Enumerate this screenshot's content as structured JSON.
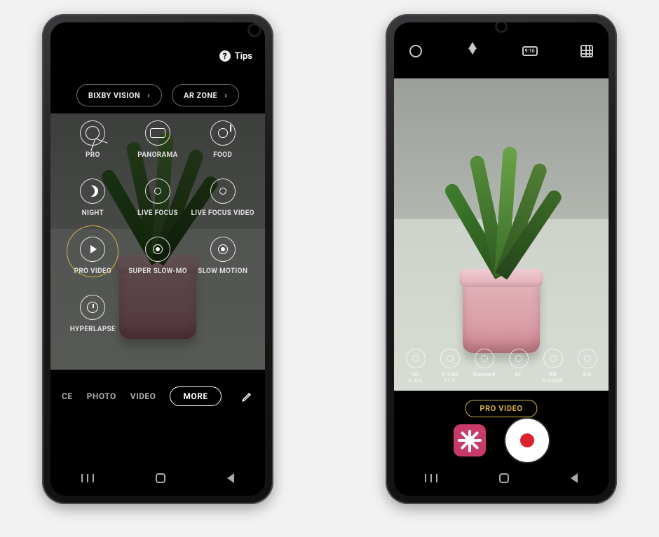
{
  "left": {
    "tips_label": "Tips",
    "chips": {
      "bixby": "BIXBY VISION",
      "arzone": "AR ZONE"
    },
    "modes": {
      "pro": "PRO",
      "panorama": "PANORAMA",
      "food": "FOOD",
      "night": "NIGHT",
      "live_focus": "LIVE FOCUS",
      "live_focus_vid": "LIVE FOCUS VIDEO",
      "pro_video": "PRO VIDEO",
      "super_slow": "SUPER SLOW-MO",
      "slow_motion": "SLOW MOTION",
      "hyperlapse": "HYPERLAPSE"
    },
    "tabs": {
      "ce": "CE",
      "photo": "PHOTO",
      "video": "VIDEO",
      "more": "MORE"
    }
  },
  "right": {
    "ratio_label": "9:16",
    "controls": {
      "iso": {
        "l1": "ISO",
        "l2": "A 400"
      },
      "shutter": {
        "l1": "A 1/50",
        "l2": "F1.5"
      },
      "color": {
        "l1": "Standard",
        "l2": ""
      },
      "focus": {
        "l1": "AF",
        "l2": ""
      },
      "wb": {
        "l1": "WB",
        "l2": "A 5400K"
      },
      "ev": {
        "l1": "0.0",
        "l2": ""
      }
    },
    "mode_label": "PRO VIDEO"
  }
}
